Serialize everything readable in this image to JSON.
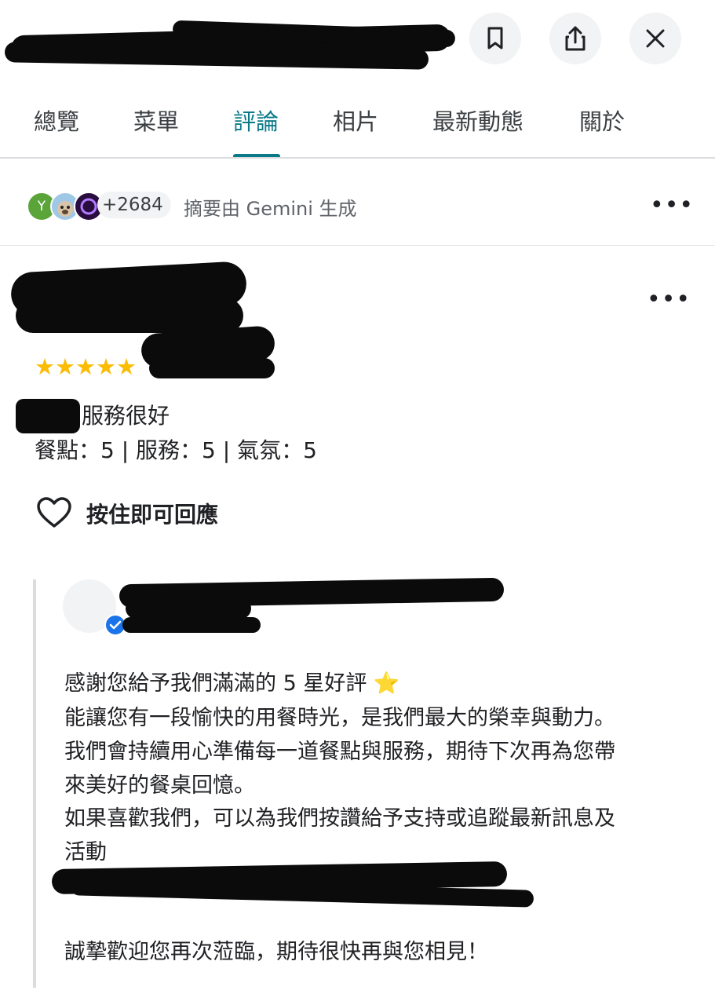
{
  "tabs": [
    "總覽",
    "菜單",
    "評論",
    "相片",
    "最新動態",
    "關於"
  ],
  "active_tab_index": 2,
  "colors": {
    "accent": "#0b7a88",
    "star": "#fbbc04",
    "verified": "#1a73e8"
  },
  "icons": [
    "bookmark-icon",
    "share-icon",
    "close-icon",
    "more-icon",
    "heart-outline-icon",
    "verified-badge-icon",
    "star-icon"
  ],
  "summary": {
    "avatar_initial": "Y",
    "count": "+2684",
    "text": "摘要由 Gemini 生成",
    "more": "•••"
  },
  "review": {
    "rating_stars": 5,
    "more": "•••",
    "text_visible": "服務很好",
    "ratings_line": "餐點：5 | 服務：5 | 氣氛：5",
    "like_label": "按住即可回應"
  },
  "owner_reply": {
    "lines": [
      "感謝您給予我們滿滿的 5 星好評 ⭐",
      "能讓您有一段愉快的用餐時光，是我們最大的榮幸與動力。",
      "我們會持續用心準備每一道餐點與服務，期待下次再為您帶",
      "來美好的餐桌回憶。",
      "如果喜歡我們，可以為我們按讚給予支持或追蹤最新訊息及",
      "活動",
      "誠摯歡迎您再次蒞臨，期待很快再與您相見！"
    ]
  }
}
